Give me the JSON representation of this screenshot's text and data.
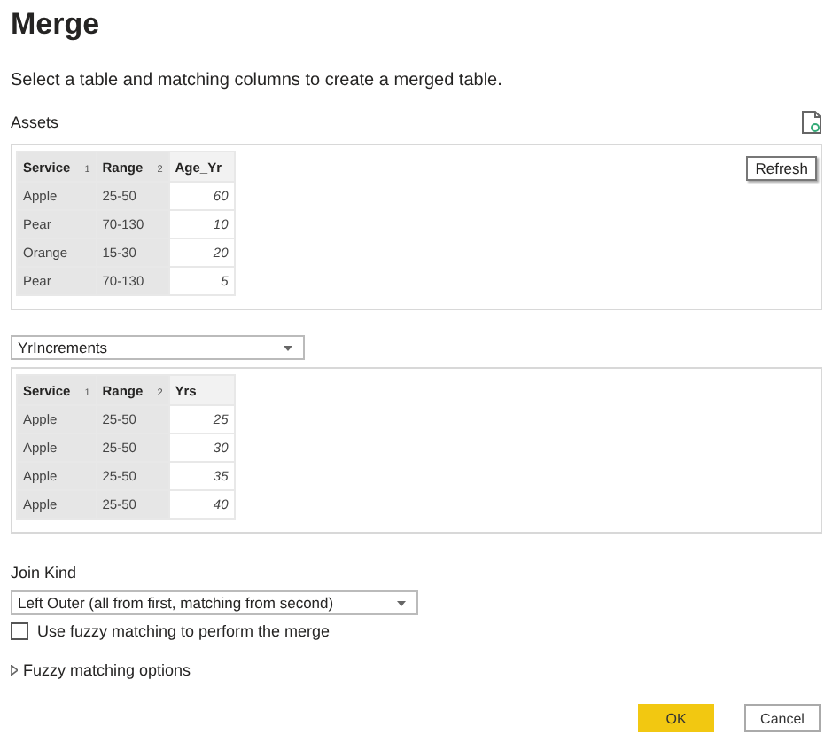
{
  "title": "Merge",
  "subtitle": "Select a table and matching columns to create a merged table.",
  "first_table": {
    "name": "Assets",
    "tooltip": "Refresh",
    "columns": [
      {
        "name": "Service",
        "order": "1",
        "selected": true,
        "kind": "text"
      },
      {
        "name": "Range",
        "order": "2",
        "selected": true,
        "kind": "text"
      },
      {
        "name": "Age_Yr",
        "selected": false,
        "kind": "number"
      }
    ],
    "rows": [
      [
        "Apple",
        "25-50",
        "60"
      ],
      [
        "Pear",
        "70-130",
        "10"
      ],
      [
        "Orange",
        "15-30",
        "20"
      ],
      [
        "Pear",
        "70-130",
        "5"
      ]
    ]
  },
  "second_table": {
    "name": "YrIncrements",
    "columns": [
      {
        "name": "Service",
        "order": "1",
        "selected": true,
        "kind": "text"
      },
      {
        "name": "Range",
        "order": "2",
        "selected": true,
        "kind": "text"
      },
      {
        "name": "Yrs",
        "selected": false,
        "kind": "number"
      }
    ],
    "rows": [
      [
        "Apple",
        "25-50",
        "25"
      ],
      [
        "Apple",
        "25-50",
        "30"
      ],
      [
        "Apple",
        "25-50",
        "35"
      ],
      [
        "Apple",
        "25-50",
        "40"
      ]
    ]
  },
  "join_kind": {
    "label": "Join Kind",
    "value": "Left Outer (all from first, matching from second)"
  },
  "fuzzy": {
    "label": "Use fuzzy matching to perform the merge",
    "checked": false
  },
  "fuzzy_options": {
    "label": "Fuzzy matching options",
    "expanded": false
  },
  "buttons": [
    {
      "label": "OK",
      "kind": "primary"
    },
    {
      "label": "Cancel",
      "kind": "secondary"
    }
  ]
}
